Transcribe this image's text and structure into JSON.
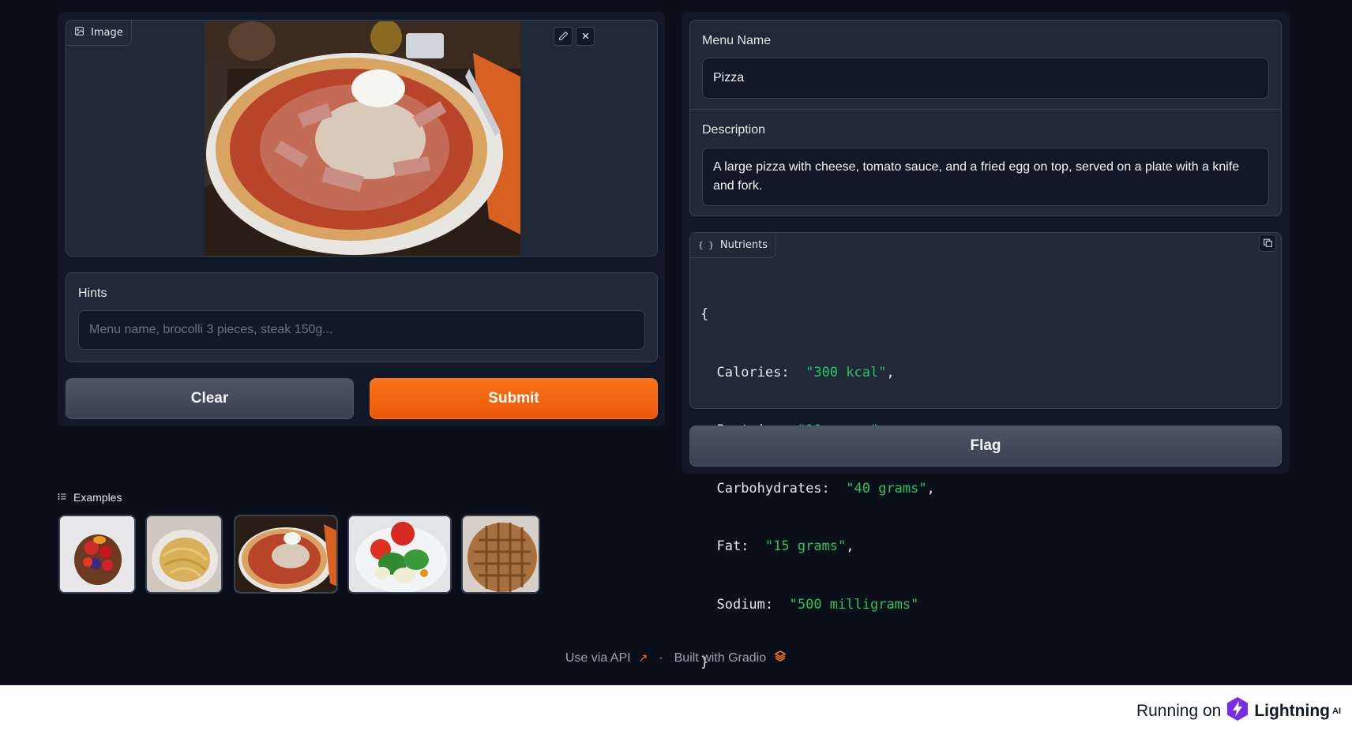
{
  "image_input": {
    "tag_label": "Image",
    "icon": "image-icon",
    "edit_icon": "pencil-icon",
    "close_icon": "close-icon"
  },
  "hints": {
    "label": "Hints",
    "placeholder": "Menu name, brocolli 3 pieces, steak 150g...",
    "value": ""
  },
  "buttons": {
    "clear": "Clear",
    "submit": "Submit",
    "flag": "Flag"
  },
  "menu_name": {
    "label": "Menu Name",
    "value": "Pizza"
  },
  "description": {
    "label": "Description",
    "value": "A large pizza with cheese, tomato sauce, and a fried egg on top, served on a plate with a knife and fork."
  },
  "nutrients": {
    "label": "Nutrients",
    "icon": "braces-icon",
    "copy_icon": "copy-icon",
    "open_brace": "{",
    "close_brace": "}",
    "items": [
      {
        "key": "Calories:",
        "value": "\"300 kcal\"",
        "sep": ","
      },
      {
        "key": "Protein:",
        "value": "\"10 grams\"",
        "sep": ","
      },
      {
        "key": "Carbohydrates:",
        "value": "\"40 grams\"",
        "sep": ","
      },
      {
        "key": "Fat:",
        "value": "\"15 grams\"",
        "sep": ","
      },
      {
        "key": "Sodium:",
        "value": "\"500 milligrams\"",
        "sep": ""
      }
    ]
  },
  "examples": {
    "label": "Examples",
    "icon": "list-icon",
    "items": [
      "fruit-tart",
      "spaghetti-carbonara",
      "pizza",
      "vegetable-salad",
      "waffle"
    ]
  },
  "footer": {
    "api": "Use via API",
    "dot": "·",
    "built": "Built with Gradio"
  },
  "bottom_bar": {
    "running_on": "Running on",
    "brand": "Lightning",
    "brand_suffix": "AI"
  },
  "colors": {
    "background": "#0b0f19",
    "panel": "#1f2937",
    "accent": "#f97316",
    "json_string": "#22c55e"
  }
}
